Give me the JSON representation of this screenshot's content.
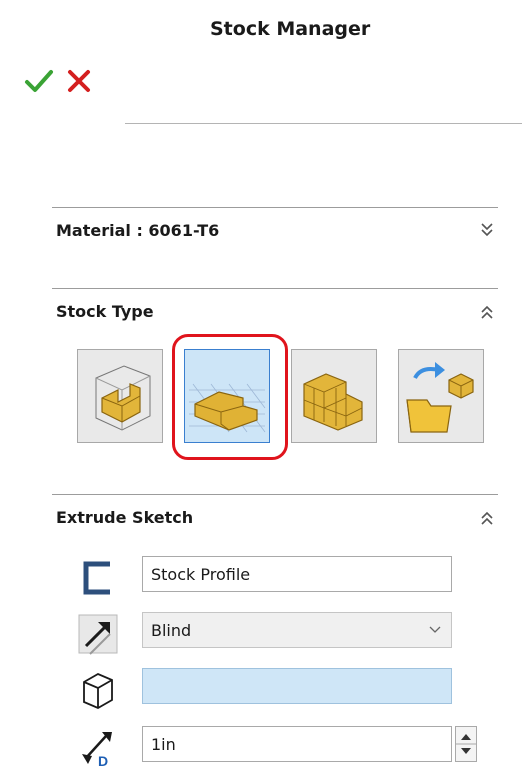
{
  "window": {
    "title": "Stock Manager"
  },
  "toolbar": {
    "ok_label": "",
    "cancel_label": ""
  },
  "material": {
    "title": "Material : 6061-T6"
  },
  "stock_type": {
    "title": "Stock Type",
    "options": [
      {
        "icon": "bounding-box-stock-icon",
        "selected": false
      },
      {
        "icon": "extrude-sketch-stock-icon",
        "selected": true
      },
      {
        "icon": "stl-stock-icon",
        "selected": false
      },
      {
        "icon": "import-stock-icon",
        "selected": false
      }
    ]
  },
  "extrude_sketch": {
    "title": "Extrude Sketch",
    "profile_value": "Stock Profile",
    "direction_value": "Blind",
    "from_value": "",
    "depth_value": "1in"
  },
  "colors": {
    "accept_green": "#3aa335",
    "cancel_red": "#d41f1f",
    "highlight_red": "#e0141c",
    "selected_blue": "#cde5f7"
  }
}
